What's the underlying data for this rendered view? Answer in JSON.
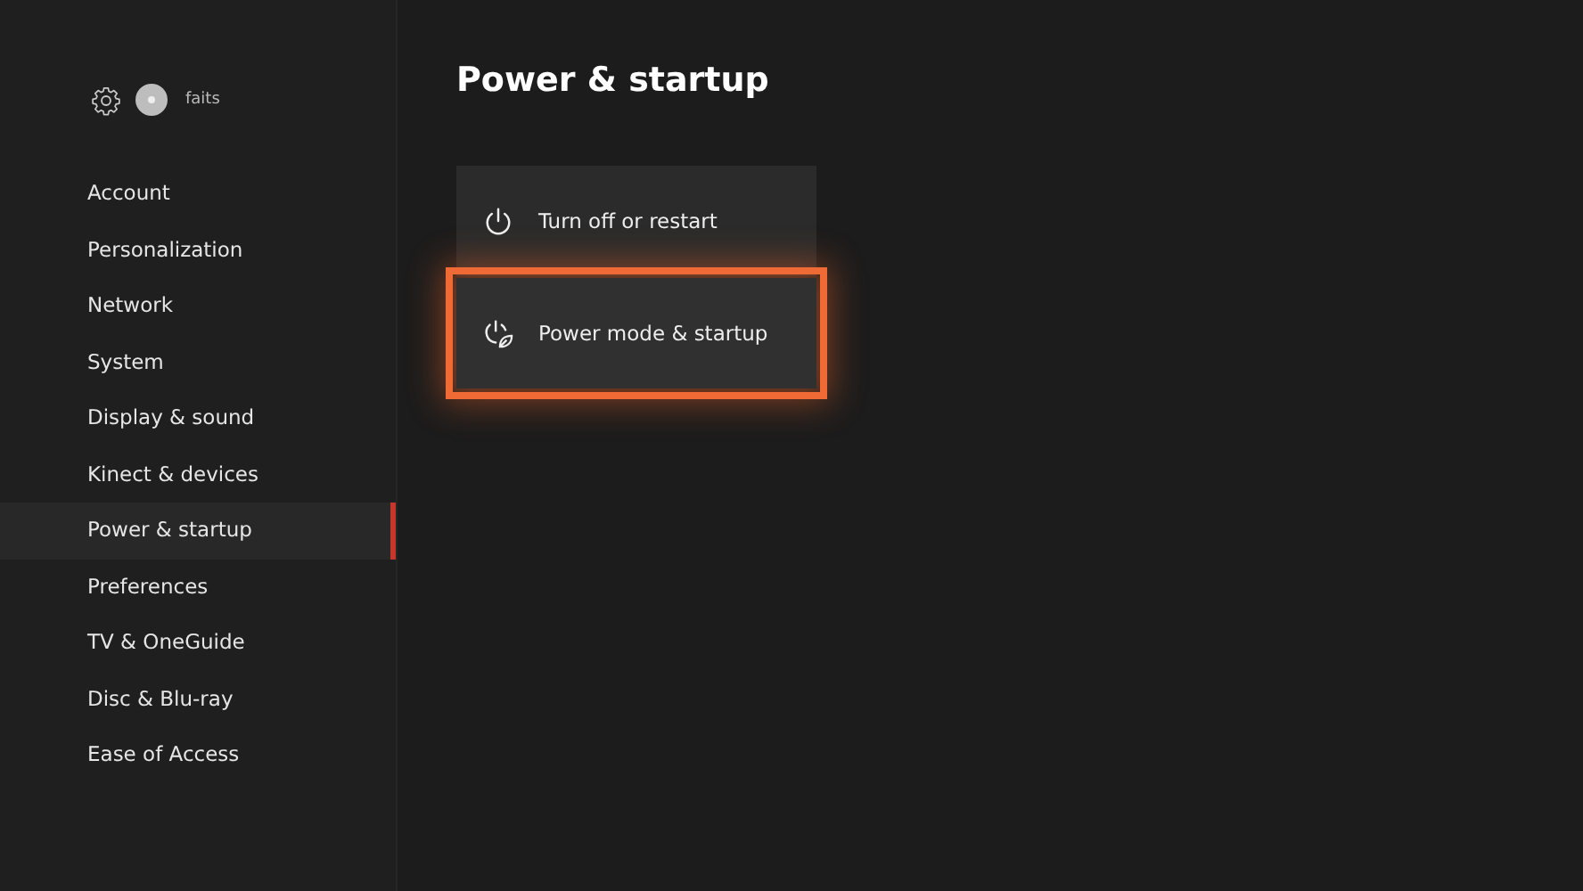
{
  "header": {
    "gamertag": "faits"
  },
  "sidebar": {
    "items": [
      {
        "label": "Account",
        "selected": false
      },
      {
        "label": "Personalization",
        "selected": false
      },
      {
        "label": "Network",
        "selected": false
      },
      {
        "label": "System",
        "selected": false
      },
      {
        "label": "Display & sound",
        "selected": false
      },
      {
        "label": "Kinect & devices",
        "selected": false
      },
      {
        "label": "Power & startup",
        "selected": true
      },
      {
        "label": "Preferences",
        "selected": false
      },
      {
        "label": "TV & OneGuide",
        "selected": false
      },
      {
        "label": "Disc & Blu-ray",
        "selected": false
      },
      {
        "label": "Ease of Access",
        "selected": false
      }
    ]
  },
  "page": {
    "title": "Power & startup",
    "tiles": [
      {
        "kind": "power",
        "label": "Turn off or restart",
        "selected": false
      },
      {
        "kind": "mode",
        "label": "Power mode & startup",
        "selected": true
      }
    ]
  }
}
